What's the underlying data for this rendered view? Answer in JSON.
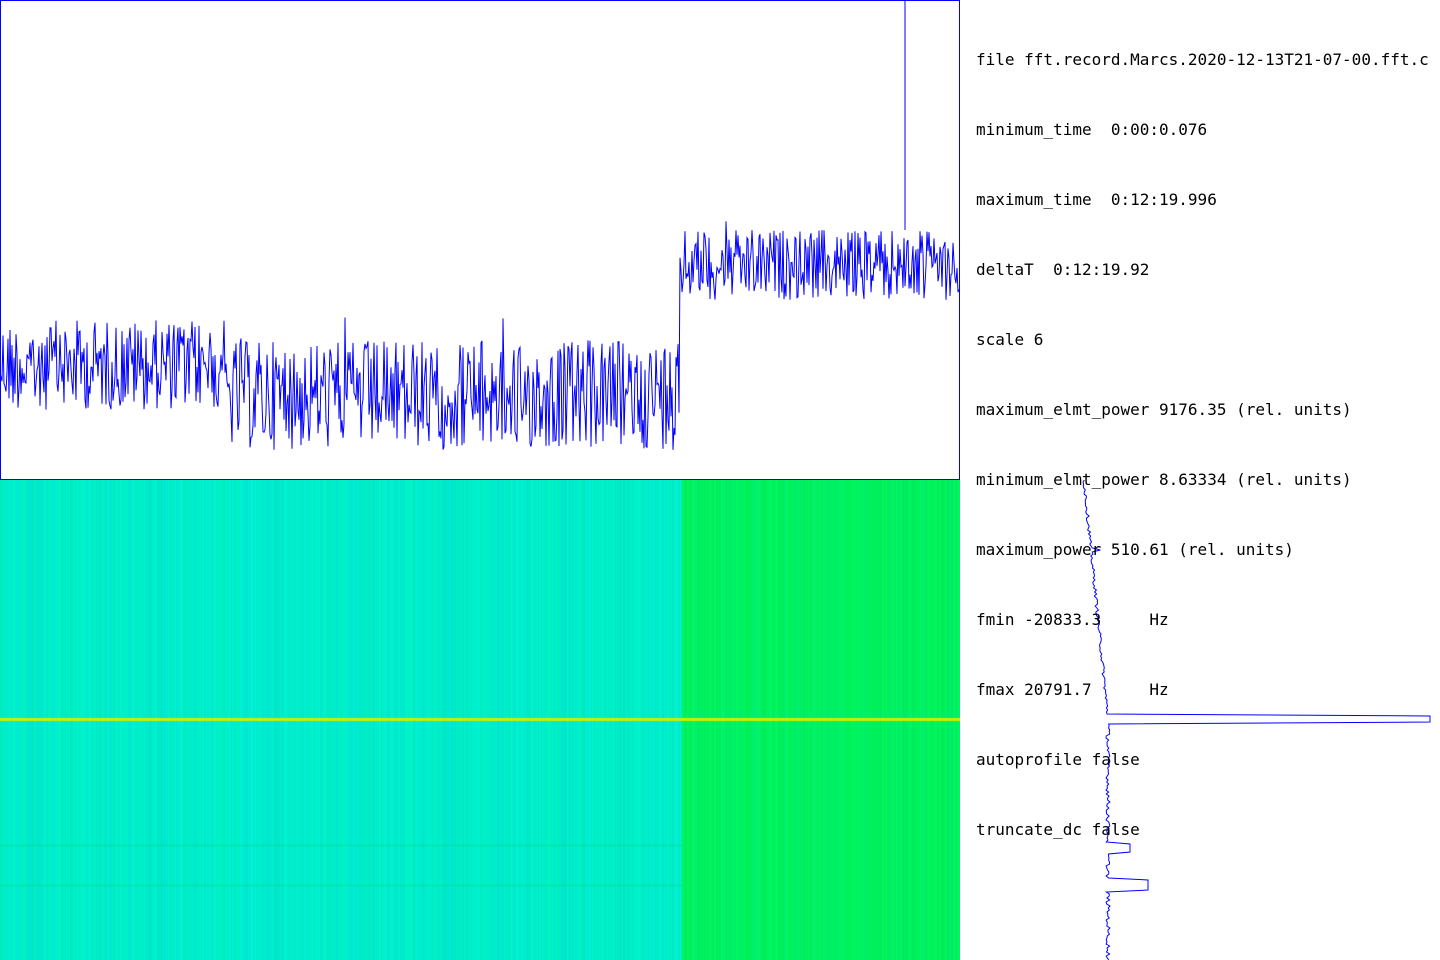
{
  "info": {
    "file": "file fft.record.Marcs.2020-12-13T21-07-00.fft.c",
    "minimum_time": "minimum_time  0:00:0.076",
    "maximum_time": "maximum_time  0:12:19.996",
    "deltaT": "deltaT  0:12:19.92",
    "scale": "scale 6",
    "maximum_elmt_power": "maximum_elmt_power 9176.35 (rel. units)",
    "minimum_elmt_power": "minimum_elmt_power 8.63334 (rel. units)",
    "maximum_power": "maximum_power 510.61 (rel. units)",
    "fmin": "fmin -20833.3     Hz",
    "fmax": "fmax 20791.7      Hz",
    "autoprofile": "autoprofile false",
    "truncate_dc": "truncate_dc false"
  },
  "colors": {
    "trace": "#0000ff",
    "frame": "#0000ff",
    "spectrogram_before": "#00f0c8",
    "spectrogram_after": "#00f070",
    "dc_line": "#c8f000"
  }
}
